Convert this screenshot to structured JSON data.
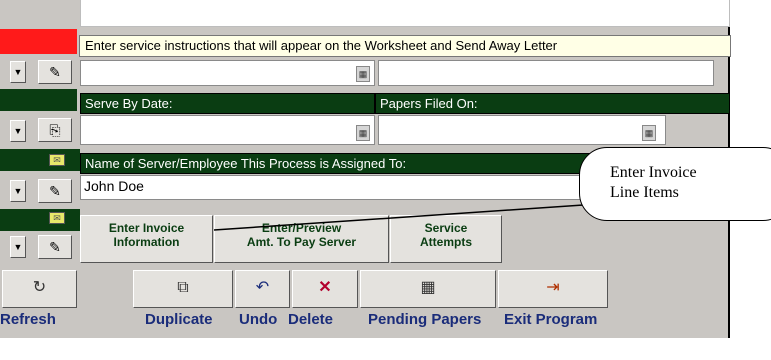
{
  "tooltip": "Enter service  instructions that will appear on the Worksheet and Send Away Letter",
  "serve_by_date": {
    "label": "Serve By Date:",
    "value": ""
  },
  "papers_filed_on": {
    "label": "Papers Filed On:",
    "value": ""
  },
  "server_employee": {
    "label": "Name of Server/Employee This Process is Assigned To:",
    "value": "John Doe"
  },
  "mid_buttons": {
    "invoice_line1": "Enter Invoice",
    "invoice_line2": "Information",
    "preview_line1": "Enter/Preview",
    "preview_line2": "Amt. To Pay Server",
    "attempts_line1": "Service",
    "attempts_line2": "Attempts"
  },
  "toolbar": {
    "refresh": "Refresh",
    "duplicate": "Duplicate",
    "undo": "Undo",
    "delete": "Delete",
    "pending": "Pending Papers",
    "exit": "Exit Program"
  },
  "callout": {
    "line1": "Enter Invoice",
    "line2": "Line Items"
  },
  "colors": {
    "dark_green": "#0a3d12",
    "red": "#ff1a1a",
    "label_blue": "#1a2c7a"
  }
}
